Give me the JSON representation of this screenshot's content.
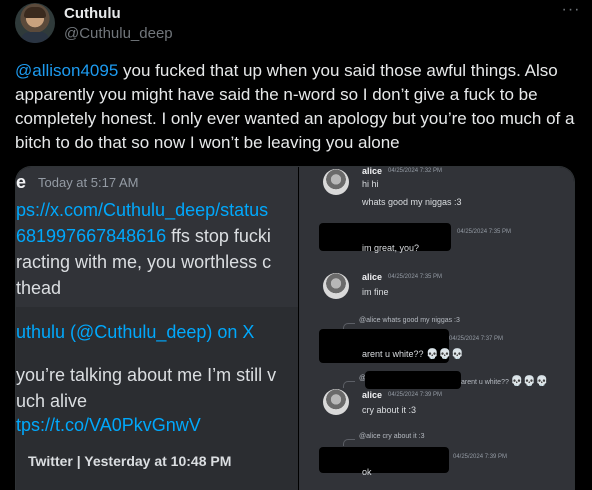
{
  "post": {
    "display_name": "Cuthulu",
    "handle": "@Cuthulu_deep",
    "more_icon": "more-horizontal-icon",
    "mention": "@allison4095",
    "text": " you fucked that up when you said those awful things. Also apparently you might have said the n-word so I don’t give a fuck to be completely honest. I only ever wanted an apology but you’re too much of a bitch to do that so now I won’t be leaving you alone"
  },
  "left_panel": {
    "author_initial": "e",
    "timestamp": "Today at 5:17 AM",
    "msg_link_1": "ps://x.com/Cuthulu_deep/status",
    "msg_link_2": "681997667848616",
    "msg_after_link": " ffs stop fucki",
    "msg_line_3": "racting with me, you worthless c",
    "msg_line_4": "thead",
    "embed_title": "uthulu (@Cuthulu_deep) on X",
    "embed_desc_1": "you’re talking about me I’m still v",
    "embed_desc_2": "uch alive",
    "embed_link": "tps://t.co/VA0PkvGnwV",
    "footer": "Twitter | Yesterday at 10:48 PM"
  },
  "right_panel": {
    "m1_name": "alice",
    "m1_ts": "04/25/2024 7:32 PM",
    "m1_line1": "hi hi",
    "m1_line2": "whats good my niggas :3",
    "m2_ts": "04/25/2024 7:35 PM",
    "m2_text": "im great, you?",
    "m3_name": "alice",
    "m3_ts": "04/25/2024 7:35 PM",
    "m3_text": "im fine",
    "m4_reply": "@alice whats good my niggas :3",
    "m4_ts": "04/25/2024 7:37 PM",
    "m4_text": "arent u white??",
    "m5_reply_prefix": "@",
    "m5_reply": "arent u white??",
    "m5_name": "alice",
    "m5_ts": "04/25/2024 7:39 PM",
    "m5_text": "cry about it :3",
    "m6_reply": "@alice cry about it :3",
    "m6_ts": "04/25/2024 7:39 PM",
    "m6_text": "ok",
    "skull": "💀"
  }
}
